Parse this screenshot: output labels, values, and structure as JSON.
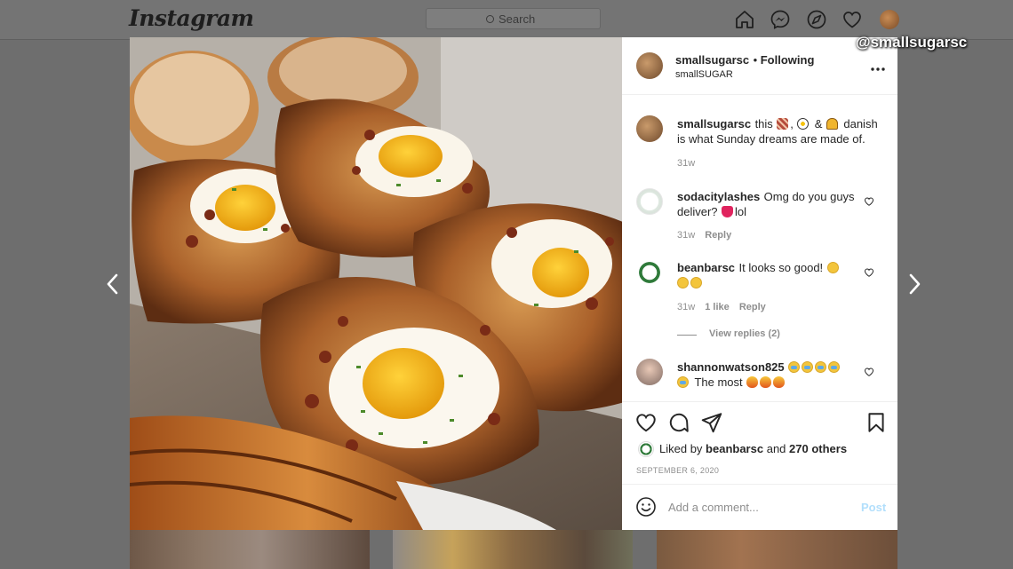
{
  "app": {
    "logo_text": "Instagram"
  },
  "search": {
    "placeholder": "Search"
  },
  "nav_icons": [
    "home-icon",
    "messenger-icon",
    "explore-icon",
    "activity-heart-icon",
    "profile-avatar"
  ],
  "watermark": "@smallsugarsc",
  "post": {
    "username": "smallsugarsc",
    "follow_status": "Following",
    "subtitle": "smallSUGAR",
    "more_icon": "more-options-icon",
    "caption": {
      "username": "smallsugarsc",
      "text_before": "this",
      "text_after": "danish",
      "text_line2": "is what Sunday dreams are made of.",
      "time": "31w"
    },
    "comments": [
      {
        "username": "sodacitylashes",
        "text_line1": "Omg do you guys",
        "text_line2_before": "deliver?",
        "text_line2_after": "lol",
        "time": "31w",
        "reply_label": "Reply"
      },
      {
        "username": "beanbarsc",
        "text_line1": "It looks so good!",
        "time": "31w",
        "likes": "1 like",
        "reply_label": "Reply",
        "view_replies": "View replies (2)"
      },
      {
        "username": "shannonwatson825",
        "text": "The most"
      }
    ],
    "liked_by_prefix": "Liked by",
    "liked_by_user": "beanbarsc",
    "liked_by_and": "and",
    "liked_by_others": "270 others",
    "date": "SEPTEMBER 6, 2020",
    "comment_placeholder": "Add a comment...",
    "post_button": "Post"
  },
  "colors": {
    "link_blue": "#0095f6",
    "post_disabled": "#b2dffc",
    "meta_gray": "#8e8e8e"
  }
}
